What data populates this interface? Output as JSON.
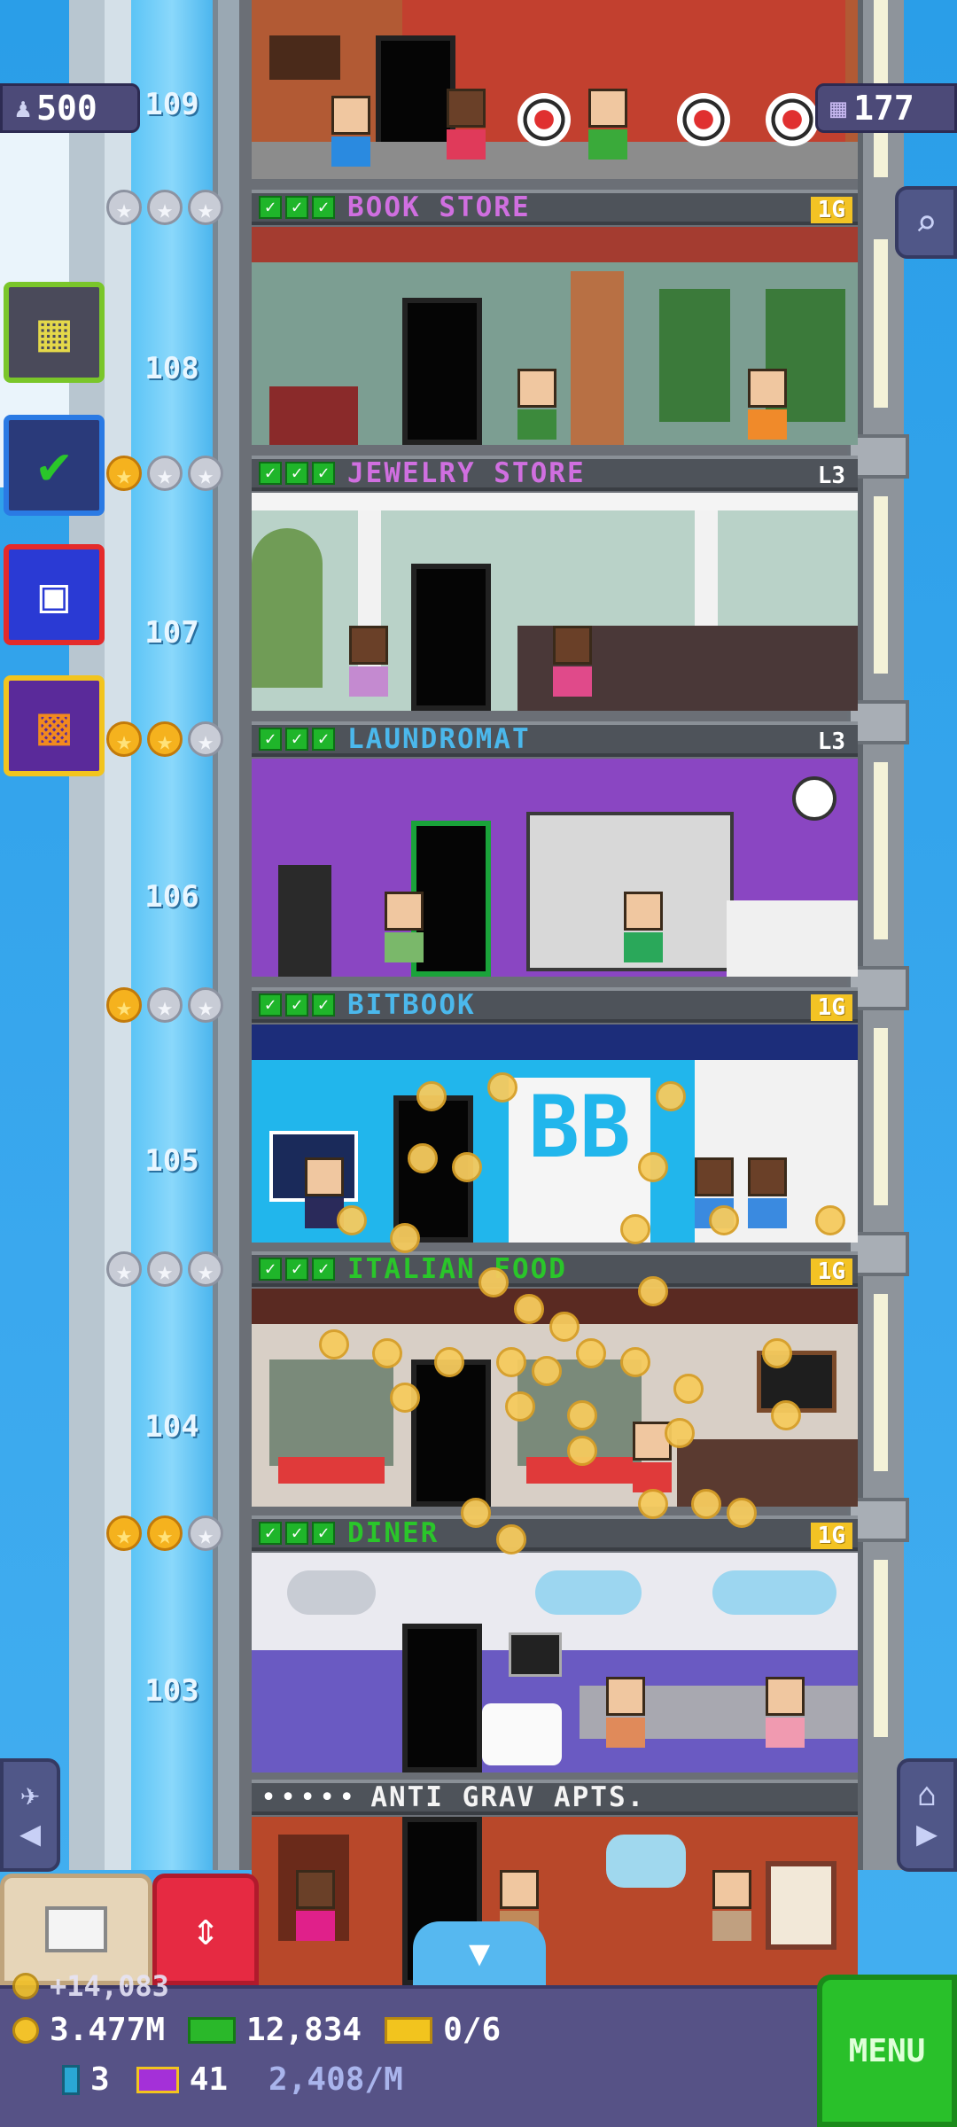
{
  "header": {
    "population": "500",
    "floors_count": "177"
  },
  "floors": [
    {
      "number": "109",
      "name": "",
      "badge": ""
    },
    {
      "number": "108",
      "name": "BOOK STORE",
      "badge": "1G",
      "badge_style": "gold",
      "stars": "none"
    },
    {
      "number": "107",
      "name": "JEWELRY STORE",
      "badge": "L3",
      "badge_style": "plain",
      "stars": "1 of 3"
    },
    {
      "number": "106",
      "name": "LAUNDROMAT",
      "badge": "L3",
      "badge_style": "plain",
      "stars": "2 of 3"
    },
    {
      "number": "105",
      "name": "BITBOOK",
      "badge": "1G",
      "badge_style": "gold",
      "stars": "1 of 3"
    },
    {
      "number": "104",
      "name": "ITALIAN FOOD",
      "badge": "1G",
      "badge_style": "gold",
      "stars": "0 of 3"
    },
    {
      "number": "103",
      "name": "DINER",
      "badge": "1G",
      "badge_style": "gold",
      "stars": "2 of 3"
    },
    {
      "number": "",
      "name": "ANTI GRAV APTS.",
      "badge": "",
      "residents_icons": "•••••"
    }
  ],
  "bitbook_sign": "BB",
  "side_buttons": [
    {
      "icon": "building-grid-icon"
    },
    {
      "icon": "checklist-icon"
    },
    {
      "icon": "calendar-icon"
    },
    {
      "icon": "gift-icon"
    }
  ],
  "bottom": {
    "coin_gain": "+14,083",
    "coins": "3.477M",
    "bux_cash": "12,834",
    "tickets": "0/6",
    "bitizen_cards": "3",
    "golden_tickets": "41",
    "income_rate": "2,408/M",
    "menu_label": "MENU"
  },
  "colors": {
    "sky": "#2a9ee8",
    "header_bar": "#4e535a",
    "badge_gold": "#f3c324",
    "check_green": "#1fb52a",
    "menu_green": "#29c02a",
    "bottom_bar": "#565286"
  }
}
